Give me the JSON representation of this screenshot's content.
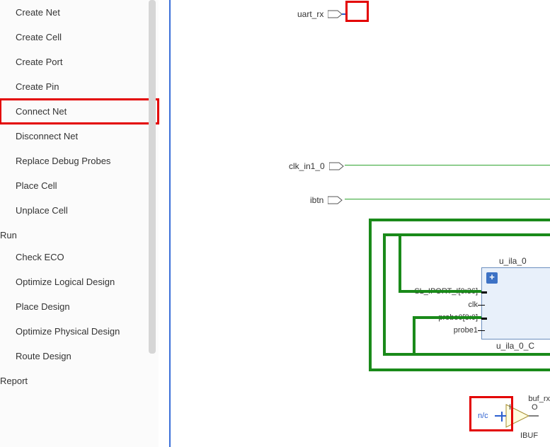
{
  "sidebar": {
    "groups": [
      {
        "items": [
          {
            "label": "Create Net",
            "name": "create-net-item"
          },
          {
            "label": "Create Cell",
            "name": "create-cell-item"
          },
          {
            "label": "Create Port",
            "name": "create-port-item"
          },
          {
            "label": "Create Pin",
            "name": "create-pin-item"
          },
          {
            "label": "Connect Net",
            "name": "connect-net-item",
            "highlighted": true
          },
          {
            "label": "Disconnect Net",
            "name": "disconnect-net-item"
          },
          {
            "label": "Replace Debug Probes",
            "name": "replace-debug-probes-item"
          },
          {
            "label": "Place Cell",
            "name": "place-cell-item"
          },
          {
            "label": "Unplace Cell",
            "name": "unplace-cell-item"
          }
        ]
      },
      {
        "header": "Run",
        "items": [
          {
            "label": "Check ECO",
            "name": "check-eco-item"
          },
          {
            "label": "Optimize Logical Design",
            "name": "optimize-logical-design-item"
          },
          {
            "label": "Place Design",
            "name": "place-design-item"
          },
          {
            "label": "Optimize Physical Design",
            "name": "optimize-physical-design-item"
          },
          {
            "label": "Route Design",
            "name": "route-design-item"
          }
        ]
      },
      {
        "header": "Report"
      }
    ]
  },
  "schematic": {
    "ports": [
      {
        "label": "uart_rx",
        "name": "uart-rx-port",
        "highlighted": true
      },
      {
        "label": "clk_in1_0",
        "name": "clk-in1-0-port"
      },
      {
        "label": "ibtn",
        "name": "ibtn-port"
      }
    ],
    "block_u_ila_0": {
      "title_top": "u_ila_0",
      "title_bottom": "u_ila_0_C",
      "pins": [
        {
          "label": "SL_IPORT_I[0:36]"
        },
        {
          "label": "clk"
        },
        {
          "label": "probe0[8:0]"
        },
        {
          "label": "probe1"
        }
      ]
    },
    "buf_rx": {
      "title": "buf_rx",
      "pin_I": "I",
      "pin_O": "O",
      "nc": "n/c",
      "footer": "IBUF"
    }
  }
}
